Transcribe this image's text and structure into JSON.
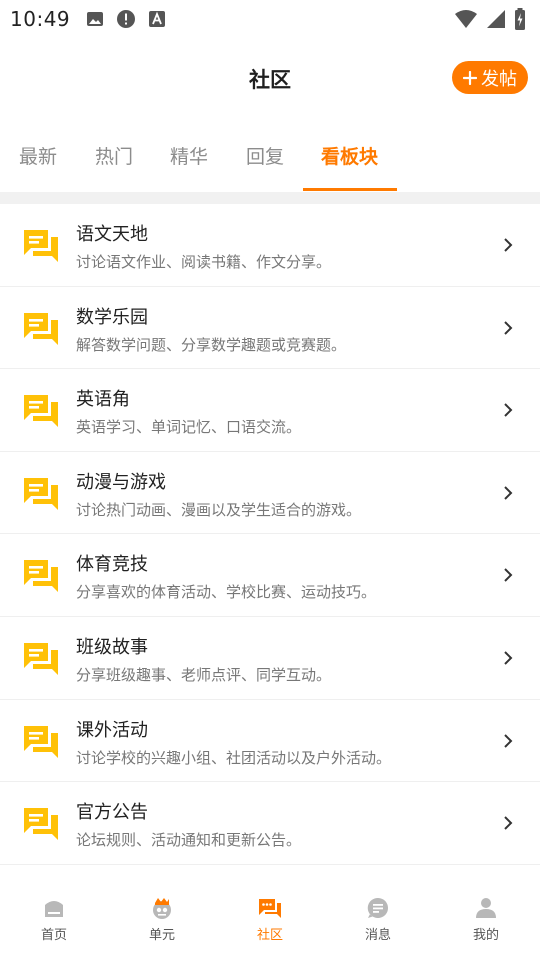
{
  "status_bar": {
    "time": "10:49"
  },
  "header": {
    "title": "社区",
    "post_button_label": "发帖",
    "post_button_icon": "plus-icon"
  },
  "tabs": [
    {
      "label": "最新",
      "active": false
    },
    {
      "label": "热门",
      "active": false
    },
    {
      "label": "精华",
      "active": false
    },
    {
      "label": "回复",
      "active": false
    },
    {
      "label": "看板块",
      "active": true
    }
  ],
  "boards": [
    {
      "name": "语文天地",
      "desc": "讨论语文作业、阅读书籍、作文分享。"
    },
    {
      "name": "数学乐园",
      "desc": "解答数学问题、分享数学趣题或竞赛题。"
    },
    {
      "name": "英语角",
      "desc": "英语学习、单词记忆、口语交流。"
    },
    {
      "name": "动漫与游戏",
      "desc": "讨论热门动画、漫画以及学生适合的游戏。"
    },
    {
      "name": "体育竞技",
      "desc": "分享喜欢的体育活动、学校比赛、运动技巧。"
    },
    {
      "name": "班级故事",
      "desc": "分享班级趣事、老师点评、同学互动。"
    },
    {
      "name": "课外活动",
      "desc": "讨论学校的兴趣小组、社团活动以及户外活动。"
    },
    {
      "name": "官方公告",
      "desc": "论坛规则、活动通知和更新公告。"
    }
  ],
  "bottom_nav": [
    {
      "label": "首页",
      "icon": "home-icon",
      "active": false
    },
    {
      "label": "单元",
      "icon": "unit-icon",
      "active": false
    },
    {
      "label": "社区",
      "icon": "community-icon",
      "active": true
    },
    {
      "label": "消息",
      "icon": "message-icon",
      "active": false
    },
    {
      "label": "我的",
      "icon": "profile-icon",
      "active": false
    }
  ],
  "colors": {
    "accent": "#ff7a00",
    "board_icon": "#ffc107",
    "inactive_tab": "#8c8c8c",
    "nav_icon": "#b8b8b8"
  }
}
